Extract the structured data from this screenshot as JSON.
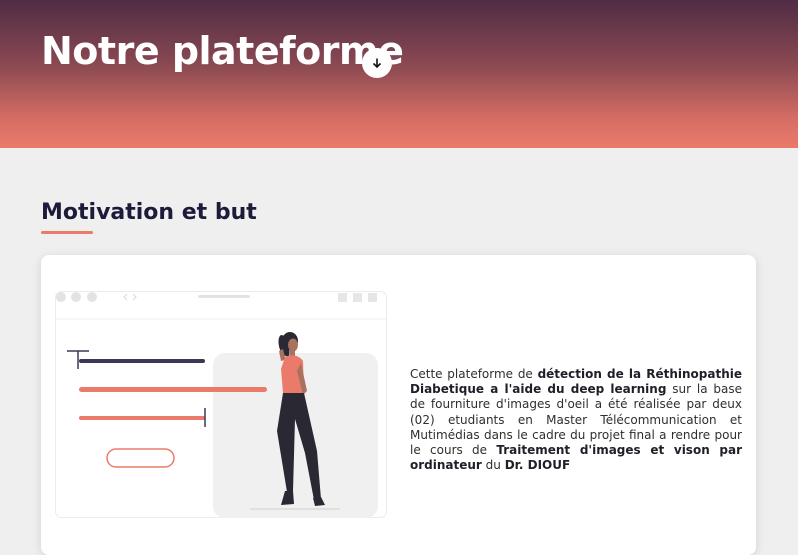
{
  "header": {
    "title": "Notre plateforme",
    "scroll_icon": "arrow-down-icon"
  },
  "section": {
    "title": "Motivation et but"
  },
  "description": {
    "p1": "Cette plateforme de ",
    "b1": "détection de la Réthinopathie Diabetique a l'aide du deep learning",
    "p2": " sur la base de fourniture d'images d'oeil a été réalisée par deux (02) etudiants en Master Télécommunication et Mutimédias dans le cadre du projet final a rendre pour le cours de ",
    "b2": "Traitement d'images et vison par ordinateur",
    "p3": " du ",
    "b3": "Dr. DIOUF"
  },
  "colors": {
    "accent": "#ea7b6b",
    "header_dark": "#4f2c45",
    "title_dark": "#1d1b3a"
  }
}
